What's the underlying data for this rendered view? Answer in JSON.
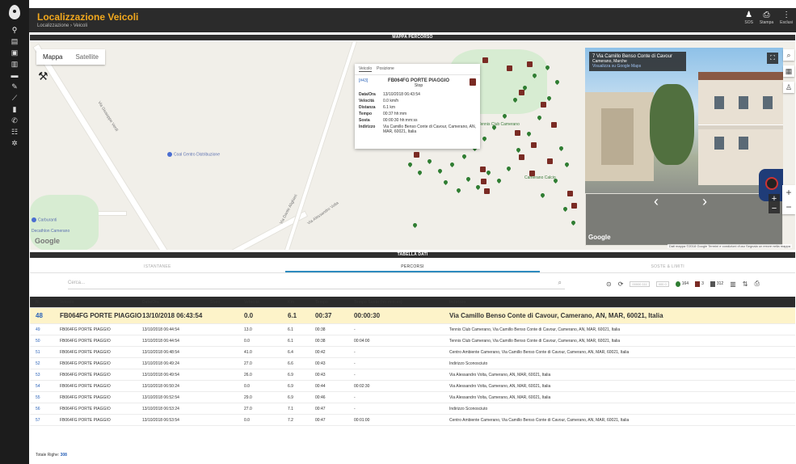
{
  "header": {
    "title": "Localizzazione Veicoli",
    "breadcrumb": "Localizzazione  ›  Veicoli",
    "actions": [
      {
        "label": "SOS",
        "icon": "person-icon"
      },
      {
        "label": "Stampa",
        "icon": "print-icon"
      },
      {
        "label": "Esclusi",
        "icon": "more-vertical-icon"
      }
    ]
  },
  "sidebar": {
    "items": [
      "map-pin-icon",
      "document-icon",
      "bus-icon",
      "fuel-icon",
      "truck-icon",
      "wrench-icon",
      "chart-icon",
      "battery-icon",
      "phone-icon",
      "users-icon",
      "settings-icon"
    ]
  },
  "map_section": {
    "bar_title": "MAPPA PERCORSO",
    "map_types": [
      "Mappa",
      "Satellite"
    ],
    "poi_labels": [
      "Coal Centro Distribuzione",
      "Carburanti",
      "Decathlon Camerano",
      "Camerano Calcio",
      "Tennis Club Camerano"
    ],
    "road_labels": [
      "Via Giuseppe Verdi",
      "Via Alessandro Volta",
      "Via Dante Alighieri"
    ],
    "google_label": "Google",
    "map_copyright": "Dati mappa ©2018 Google   Termini e condizioni d'uso   Segnala un errore nella mappa"
  },
  "popup": {
    "tabs": [
      "Veicolo",
      "Posizione"
    ],
    "index": "[#43]",
    "vehicle": "FB064FG PORTE PIAGGIO",
    "status": "Stop",
    "fields": [
      {
        "k": "Data/Ora",
        "v": "13/10/2018 06:43:54"
      },
      {
        "k": "Velocità",
        "v": "0.0 km/h"
      },
      {
        "k": "Distanza",
        "v": "6.1 km"
      },
      {
        "k": "Tempo",
        "v": "00:37 hh:mm"
      },
      {
        "k": "Sosta",
        "v": "00:00:30 hh:mm:ss"
      },
      {
        "k": "Indirizzo",
        "v": "Via Camillo Benso Conte di Cavour, Camerano, AN, MAR, 60021, Italia"
      }
    ]
  },
  "street_view": {
    "address_line1": "7 Via Camillo Benso Conte di Cavour",
    "address_line2": "Camerano, Marche",
    "address_link": "Visualizza su Google Maps",
    "google_label": "Google",
    "copyright": "© 2018 Google   Termini e condizioni d'uso   Segnala un problema"
  },
  "table_section": {
    "bar_title": "TABELLA DATI",
    "tabs": [
      "ISTANTANEE",
      "PERCORSI",
      "SOSTE & LIMITI"
    ],
    "active_tab": 1,
    "search_placeholder": "Cerca...",
    "counts": {
      "go": "164",
      "stop": "3",
      "other": "312"
    },
    "filters": [
      "00000 111",
      "000 0"
    ],
    "columns": [
      "N.",
      "Veicolo",
      "Data/Ora",
      "Stato",
      "Velocità",
      "Km",
      "Tempo",
      "Tempo Sosta (hh:mm:ss)",
      "Indirizzo"
    ],
    "rows": [
      {
        "n": "48",
        "veicolo": "FB064FG PORTE PIAGGIO",
        "data": "13/10/2018 06:43:54",
        "stato": "stop",
        "vel": "0.0",
        "km": "6.1",
        "tempo": "00:37",
        "sosta": "00:00:30",
        "indirizzo": "Via Camillo Benso Conte di Cavour, Camerano, AN, MAR, 60021, Italia",
        "selected": true
      },
      {
        "n": "49",
        "veicolo": "FB064FG PORTE PIAGGIO",
        "data": "13/10/2018 06:44:54",
        "stato": "go",
        "vel": "13.0",
        "km": "6.1",
        "tempo": "00:38",
        "sosta": "-",
        "indirizzo": "Tennis Club Camerano, Via Camillo Benso Conte di Cavour, Camerano, AN, MAR, 60021, Italia"
      },
      {
        "n": "50",
        "veicolo": "FB064FG PORTE PIAGGIO",
        "data": "13/10/2018 06:44:54",
        "stato": "stop",
        "vel": "0.0",
        "km": "6.1",
        "tempo": "00:38",
        "sosta": "00:04:00",
        "indirizzo": "Tennis Club Camerano, Via Camillo Benso Conte di Cavour, Camerano, AN, MAR, 60021, Italia"
      },
      {
        "n": "51",
        "veicolo": "FB064FG PORTE PIAGGIO",
        "data": "13/10/2018 06:48:54",
        "stato": "go",
        "vel": "41.0",
        "km": "6.4",
        "tempo": "00:42",
        "sosta": "-",
        "indirizzo": "Centro Ambiente Camerano, Via Camillo Benso Conte di Cavour, Camerano, AN, MAR, 60021, Italia"
      },
      {
        "n": "52",
        "veicolo": "FB064FG PORTE PIAGGIO",
        "data": "13/10/2018 06:49:24",
        "stato": "go",
        "vel": "27.0",
        "km": "6.6",
        "tempo": "00:43",
        "sosta": "-",
        "indirizzo": "Indirizzo Sconosciuto"
      },
      {
        "n": "53",
        "veicolo": "FB064FG PORTE PIAGGIO",
        "data": "13/10/2018 06:49:54",
        "stato": "go",
        "vel": "26.0",
        "km": "6.9",
        "tempo": "00:43",
        "sosta": "-",
        "indirizzo": "Via Alessandro Volta, Camerano, AN, MAR, 60021, Italia"
      },
      {
        "n": "54",
        "veicolo": "FB064FG PORTE PIAGGIO",
        "data": "13/10/2018 06:50:24",
        "stato": "stop",
        "vel": "0.0",
        "km": "6.9",
        "tempo": "00:44",
        "sosta": "00:02:30",
        "indirizzo": "Via Alessandro Volta, Camerano, AN, MAR, 60021, Italia"
      },
      {
        "n": "55",
        "veicolo": "FB064FG PORTE PIAGGIO",
        "data": "13/10/2018 06:52:54",
        "stato": "go",
        "vel": "29.0",
        "km": "6.9",
        "tempo": "00:46",
        "sosta": "-",
        "indirizzo": "Via Alessandro Volta, Camerano, AN, MAR, 60021, Italia"
      },
      {
        "n": "56",
        "veicolo": "FB064FG PORTE PIAGGIO",
        "data": "13/10/2018 06:53:24",
        "stato": "go",
        "vel": "27.0",
        "km": "7.1",
        "tempo": "00:47",
        "sosta": "-",
        "indirizzo": "Indirizzo Sconosciuto"
      },
      {
        "n": "57",
        "veicolo": "FB064FG PORTE PIAGGIO",
        "data": "13/10/2018 06:53:54",
        "stato": "stop",
        "vel": "0.0",
        "km": "7.2",
        "tempo": "00:47",
        "sosta": "00:01:00",
        "indirizzo": "Centro Ambiente Camerano, Via Camillo Benso Conte di Cavour, Camerano, AN, MAR, 60021, Italia"
      }
    ],
    "footer_label": "Totale Righe:",
    "footer_count": "308"
  }
}
